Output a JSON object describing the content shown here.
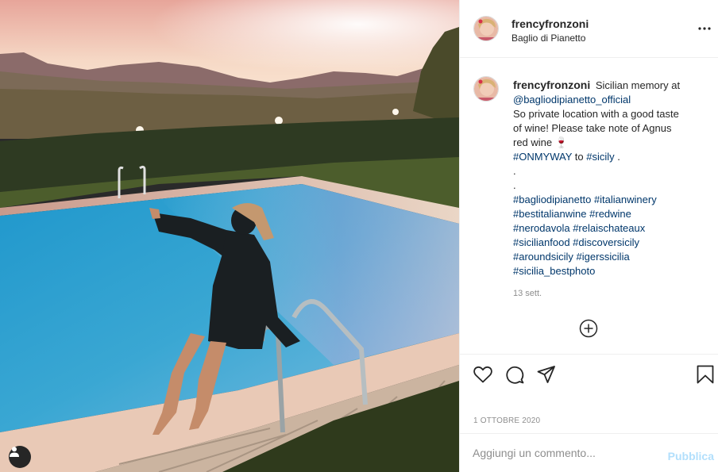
{
  "post": {
    "username": "frencyfronzoni",
    "location": "Baglio di Pianetto",
    "caption": {
      "text_1": "Sicilian memory at",
      "mention": "@bagliodipianetto_official",
      "text_2": "So private location with a good taste",
      "text_3": "of wine! Please take note of Agnus",
      "text_4": "red wine",
      "emoji": "🍷",
      "hashtag_onmyway": "#ONMYWAY",
      "to_word": "to",
      "hashtag_sicily": "#sicily",
      "dot_after": ".",
      "dot_1": ".",
      "dot_2": ".",
      "tags_1": [
        "#bagliodipianetto",
        "#italianwinery"
      ],
      "tags_2": [
        "#bestitalianwine",
        "#redwine"
      ],
      "tags_3": [
        "#nerodavola",
        "#relaischateaux"
      ],
      "tags_4": [
        "#sicilianfood",
        "#discoversicily"
      ],
      "tags_5": [
        "#aroundsicily",
        "#igerssicilia"
      ],
      "tags_6": [
        "#sicilia_bestphoto"
      ]
    },
    "time_ago": "13 sett.",
    "date": "1 OTTOBRE 2020"
  },
  "comment_box": {
    "placeholder": "Aggiungi un commento...",
    "publish_label": "Pubblica"
  },
  "icons": {
    "more": "more-options-icon",
    "heart": "heart-icon",
    "comment": "comment-icon",
    "share": "share-icon",
    "save": "bookmark-icon",
    "load_more": "plus-circle-icon",
    "user_tag": "user-icon"
  },
  "colors": {
    "link": "#00376b",
    "muted": "#8e8e8e",
    "publish_disabled": "#b2dffc",
    "pool": "#2a9fd0"
  }
}
